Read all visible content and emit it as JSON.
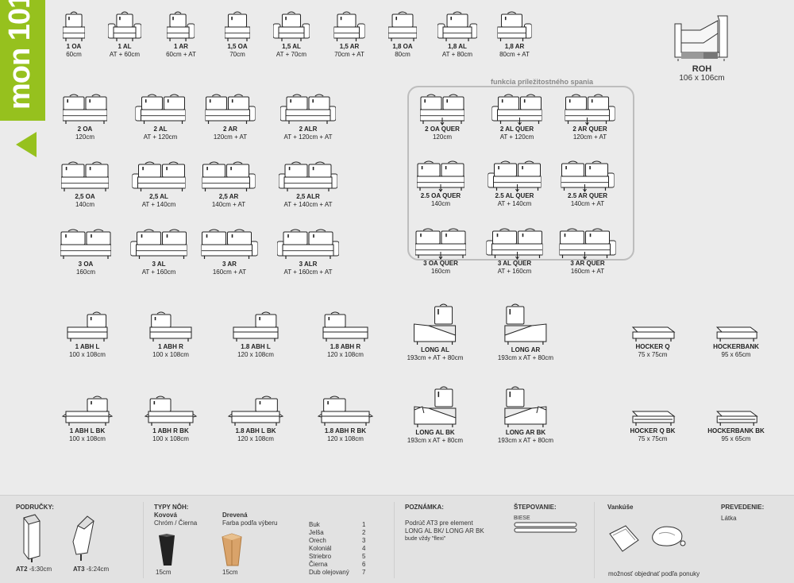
{
  "brand": "mon 101",
  "quer_title": "funkcia príležitostného spania",
  "corner": {
    "name": "ROH",
    "dim": "106 x 106cm"
  },
  "items": [
    {
      "name": "1 OA",
      "dim": "60cm"
    },
    {
      "name": "1 AL",
      "dim": "AT + 60cm"
    },
    {
      "name": "1 AR",
      "dim": "60cm + AT"
    },
    {
      "name": "1,5 OA",
      "dim": "70cm"
    },
    {
      "name": "1,5 AL",
      "dim": "AT + 70cm"
    },
    {
      "name": "1,5 AR",
      "dim": "70cm + AT"
    },
    {
      "name": "1,8 OA",
      "dim": "80cm"
    },
    {
      "name": "1,8 AL",
      "dim": "AT + 80cm"
    },
    {
      "name": "1,8 AR",
      "dim": "80cm + AT"
    },
    {
      "name": "2 OA",
      "dim": "120cm"
    },
    {
      "name": "2 AL",
      "dim": "AT + 120cm"
    },
    {
      "name": "2 AR",
      "dim": "120cm + AT"
    },
    {
      "name": "2 ALR",
      "dim": "AT + 120cm + AT"
    },
    {
      "name": "2,5 OA",
      "dim": "140cm"
    },
    {
      "name": "2,5 AL",
      "dim": "AT + 140cm"
    },
    {
      "name": "2,5 AR",
      "dim": "140cm + AT"
    },
    {
      "name": "2,5 ALR",
      "dim": "AT + 140cm + AT"
    },
    {
      "name": "3 OA",
      "dim": "160cm"
    },
    {
      "name": "3 AL",
      "dim": "AT + 160cm"
    },
    {
      "name": "3 AR",
      "dim": "160cm + AT"
    },
    {
      "name": "3 ALR",
      "dim": "AT + 160cm + AT"
    },
    {
      "name": "2 OA QUER",
      "dim": "120cm"
    },
    {
      "name": "2 AL QUER",
      "dim": "AT + 120cm"
    },
    {
      "name": "2 AR QUER",
      "dim": "120cm + AT"
    },
    {
      "name": "2.5 OA QUER",
      "dim": "140cm"
    },
    {
      "name": "2.5 AL QUER",
      "dim": "AT + 140cm"
    },
    {
      "name": "2.5 AR QUER",
      "dim": "140cm + AT"
    },
    {
      "name": "3 OA QUER",
      "dim": "160cm"
    },
    {
      "name": "3 AL QUER",
      "dim": "AT + 160cm"
    },
    {
      "name": "3 AR QUER",
      "dim": "160cm + AT"
    },
    {
      "name": "1 ABH L",
      "dim": "100 x 108cm"
    },
    {
      "name": "1 ABH R",
      "dim": "100 x 108cm"
    },
    {
      "name": "1.8 ABH L",
      "dim": "120 x 108cm"
    },
    {
      "name": "1.8 ABH R",
      "dim": "120 x 108cm"
    },
    {
      "name": "LONG AL",
      "dim": "193cm + AT + 80cm"
    },
    {
      "name": "LONG AR",
      "dim": "193cm x AT + 80cm"
    },
    {
      "name": "HOCKER Q",
      "dim": "75 x 75cm"
    },
    {
      "name": "HOCKERBANK",
      "dim": "95 x 65cm"
    },
    {
      "name": "1 ABH L BK",
      "dim": "100 x 108cm"
    },
    {
      "name": "1 ABH R BK",
      "dim": "100 x 108cm"
    },
    {
      "name": "1.8 ABH L BK",
      "dim": "120 x 108cm"
    },
    {
      "name": "1.8 ABH R BK",
      "dim": "120 x 108cm"
    },
    {
      "name": "LONG AL BK",
      "dim": "193cm x AT + 80cm"
    },
    {
      "name": "LONG AR BK",
      "dim": "193cm x AT + 80cm"
    },
    {
      "name": "HOCKER Q BK",
      "dim": "75 x 75cm"
    },
    {
      "name": "HOCKERBANK BK",
      "dim": "95 x 65cm"
    }
  ],
  "footer": {
    "armrests": {
      "title": "PODRUČKY:",
      "at2": "AT2",
      "at2_dim": "-š:30cm",
      "at3": "AT3",
      "at3_dim": "-š:24cm"
    },
    "legs": {
      "title": "TYPY NÔH:",
      "metal_title": "Kovová",
      "metal_finish": "Chróm / Čierna",
      "metal_size": "15cm",
      "wood_title": "Drevená",
      "wood_finish": "Farba podľa výberu",
      "wood_size": "15cm"
    },
    "woods": [
      {
        "name": "Buk",
        "code": "1"
      },
      {
        "name": "Jelša",
        "code": "2"
      },
      {
        "name": "Orech",
        "code": "3"
      },
      {
        "name": "Koloniál",
        "code": "4"
      },
      {
        "name": "Striebro",
        "code": "5"
      },
      {
        "name": "Čierna",
        "code": "6"
      },
      {
        "name": "Dub olejovaný",
        "code": "7"
      }
    ],
    "note": {
      "title": "POZNÁMKA:",
      "line1": "Podrúč AT3 pre element",
      "line2": "LONG AL BK/ LONG AR BK",
      "line3": "bude vždy \"flexi\""
    },
    "stitching": {
      "title": "ŠTEPOVANIE:",
      "type": "BIESE"
    },
    "cushions": {
      "title": "Vankúše",
      "note": "možnosť objednať podľa ponuky"
    },
    "version": {
      "title": "PREVEDENIE:",
      "value": "Látka"
    }
  }
}
